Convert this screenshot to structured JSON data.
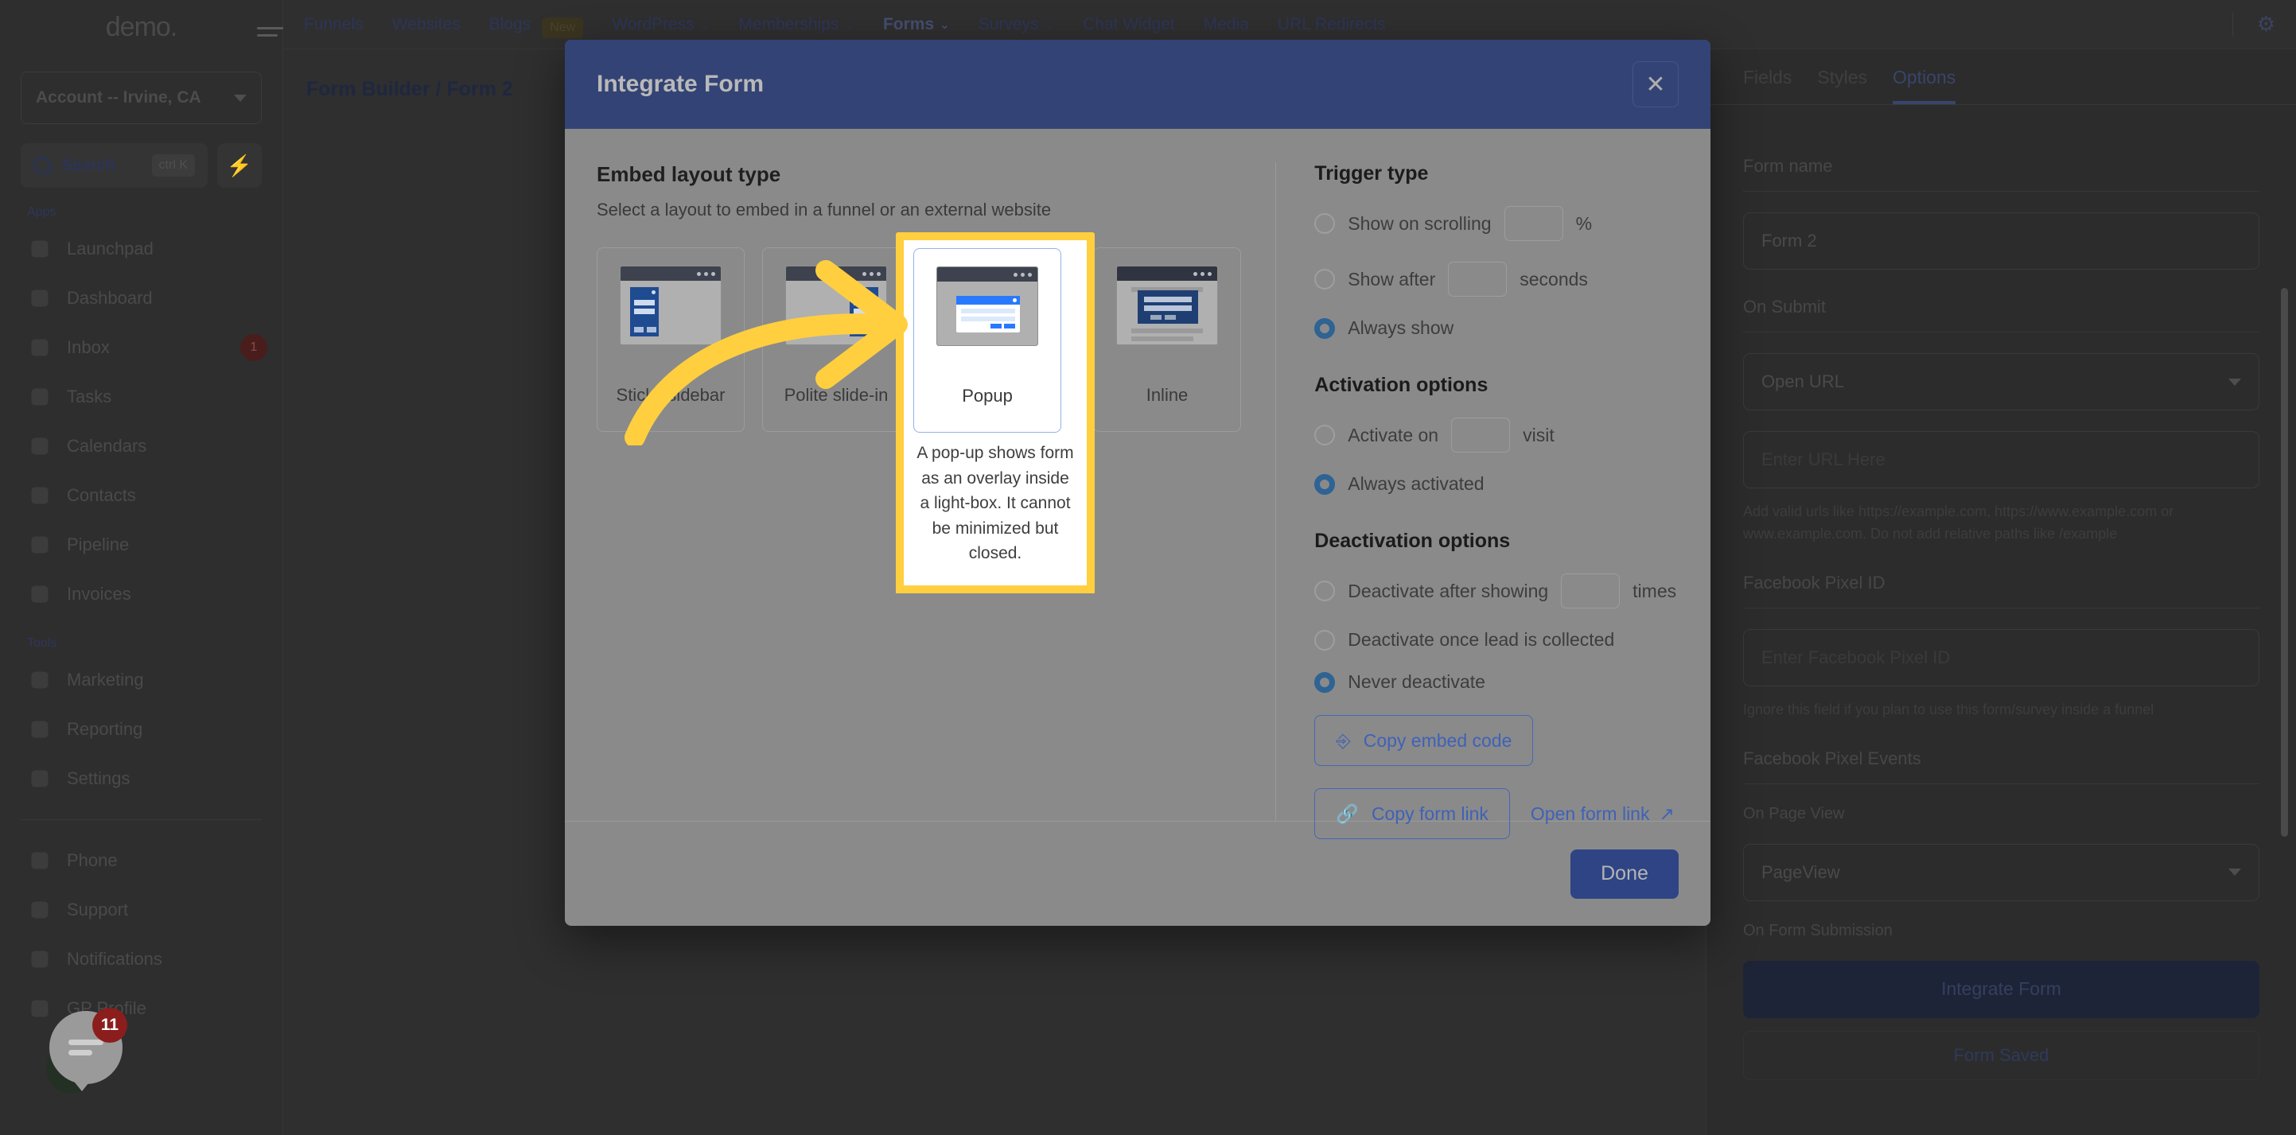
{
  "sidebar": {
    "brand": "demo.",
    "account": "Account -- Irvine, CA",
    "search": {
      "placeholder": "Search",
      "shortcut": "ctrl K"
    },
    "groups": [
      {
        "label": "Apps",
        "items": [
          {
            "label": "Launchpad",
            "icon": "launchpad-icon",
            "badge": ""
          },
          {
            "label": "Dashboard",
            "icon": "dashboard-icon",
            "badge": ""
          },
          {
            "label": "Inbox",
            "icon": "inbox-icon",
            "badge": "1"
          },
          {
            "label": "Tasks",
            "icon": "tasks-icon",
            "badge": ""
          },
          {
            "label": "Calendars",
            "icon": "calendar-icon",
            "badge": ""
          },
          {
            "label": "Contacts",
            "icon": "contacts-icon",
            "badge": ""
          },
          {
            "label": "Pipeline",
            "icon": "pipeline-icon",
            "badge": ""
          },
          {
            "label": "Invoices",
            "icon": "invoices-icon",
            "badge": ""
          }
        ]
      },
      {
        "label": "Tools",
        "items": [
          {
            "label": "Marketing",
            "icon": "megaphone-icon",
            "badge": ""
          },
          {
            "label": "Reporting",
            "icon": "pie-chart-icon",
            "badge": ""
          },
          {
            "label": "Settings",
            "icon": "gear-icon",
            "badge": ""
          }
        ]
      },
      {
        "label": "",
        "items": [
          {
            "label": "Phone",
            "icon": "phone-icon",
            "badge": ""
          },
          {
            "label": "Support",
            "icon": "support-icon",
            "badge": ""
          },
          {
            "label": "Notifications",
            "icon": "bell-icon",
            "badge": ""
          },
          {
            "label": "GP Profile",
            "icon": "avatar-icon",
            "badge": ""
          }
        ]
      }
    ],
    "chat_badge": "11"
  },
  "topnav": {
    "items": [
      {
        "label": "Funnels",
        "caret": false,
        "badge": ""
      },
      {
        "label": "Websites",
        "caret": false,
        "badge": ""
      },
      {
        "label": "Blogs",
        "caret": false,
        "badge": "New"
      },
      {
        "label": "WordPress",
        "caret": true,
        "badge": ""
      },
      {
        "label": "Memberships",
        "caret": true,
        "badge": ""
      },
      {
        "label": "Forms",
        "caret": true,
        "badge": "",
        "active": true
      },
      {
        "label": "Surveys",
        "caret": true,
        "badge": ""
      },
      {
        "label": "Chat Widget",
        "caret": false,
        "badge": ""
      },
      {
        "label": "Media",
        "caret": false,
        "badge": ""
      },
      {
        "label": "URL Redirects",
        "caret": false,
        "badge": ""
      }
    ],
    "caret_glyph": "⌄",
    "gear_glyph": "⚙"
  },
  "breadcrumb": "Form Builder / Form 2",
  "right_panel": {
    "tabs": [
      {
        "label": "Fields",
        "active": false
      },
      {
        "label": "Styles",
        "active": false
      },
      {
        "label": "Options",
        "active": true
      }
    ],
    "form_name_label": "Form name",
    "form_name_value": "Form 2",
    "on_submit_label": "On Submit",
    "on_submit_value": "Open URL",
    "url_placeholder": "Enter URL Here",
    "url_help": "Add valid urls like https://example.com, https://www.example.com or www.example.com. Do not add relative paths like /example",
    "fb_pixel_id_label": "Facebook Pixel ID",
    "fb_pixel_id_placeholder": "Enter Facebook Pixel ID",
    "fb_pixel_help": "Ignore this field if you plan to use this form/survey inside a funnel",
    "fb_pixel_events_label": "Facebook Pixel Events",
    "on_page_view_label": "On Page View",
    "on_page_view_value": "PageView",
    "on_form_submission_label": "On Form Submission",
    "integrate_form_button": "Integrate Form",
    "form_saved_button": "Form Saved"
  },
  "modal": {
    "title": "Integrate Form",
    "close_glyph": "✕",
    "embed": {
      "heading": "Embed layout type",
      "subheading": "Select a layout to embed in a funnel or an external website",
      "cards": [
        {
          "label": "Sticky sidebar",
          "selected": false
        },
        {
          "label": "Polite slide-in",
          "selected": false
        },
        {
          "label": "Popup",
          "selected": true
        },
        {
          "label": "Inline",
          "selected": false
        }
      ],
      "selected_description": "A pop-up shows form as an overlay inside a light-box. It cannot be minimized but closed."
    },
    "trigger": {
      "heading": "Trigger type",
      "options": [
        {
          "label": "Show on scrolling",
          "selected": false,
          "input": true,
          "input_value": "",
          "suffix": "%"
        },
        {
          "label": "Show after",
          "selected": false,
          "input": true,
          "input_value": "",
          "suffix": "seconds"
        },
        {
          "label": "Always show",
          "selected": true,
          "input": false,
          "input_value": "",
          "suffix": ""
        }
      ]
    },
    "activation": {
      "heading": "Activation options",
      "options": [
        {
          "label": "Activate on",
          "selected": false,
          "input": true,
          "input_value": "",
          "suffix": "visit"
        },
        {
          "label": "Always activated",
          "selected": true,
          "input": false,
          "input_value": "",
          "suffix": ""
        }
      ]
    },
    "deactivation": {
      "heading": "Deactivation options",
      "options": [
        {
          "label": "Deactivate after showing",
          "selected": false,
          "input": true,
          "input_value": "",
          "suffix": "times"
        },
        {
          "label": "Deactivate once lead is collected",
          "selected": false,
          "input": false,
          "input_value": "",
          "suffix": ""
        },
        {
          "label": "Never deactivate",
          "selected": true,
          "input": false,
          "input_value": "",
          "suffix": ""
        }
      ]
    },
    "copy_embed_code": "Copy embed code",
    "copy_form_link": "Copy form link",
    "open_form_link": "Open form link",
    "done_button": "Done"
  },
  "colors": {
    "modal_header": "#334375",
    "highlight": "#FFCF3F",
    "accent_blue": "#3f62b7",
    "radio_on": "#2e6394",
    "done_button": "#2e4485"
  }
}
